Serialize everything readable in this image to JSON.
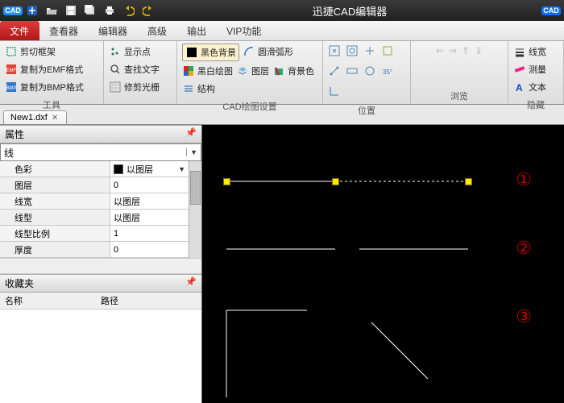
{
  "title": "迅捷CAD编辑器",
  "menu": {
    "file": "文件",
    "viewer": "查看器",
    "editor": "编辑器",
    "adv": "高级",
    "output": "输出",
    "vip": "VIP功能"
  },
  "ribbon": {
    "g1": {
      "crop": "剪切框架",
      "emf": "复制为EMF格式",
      "bmp": "复制为BMP格式",
      "label": "工具"
    },
    "g2": {
      "pts": "显示点",
      "find": "查找文字",
      "trim": "修剪光栅"
    },
    "g3": {
      "bg": "黑色背景",
      "bw": "黑白绘图",
      "bgcolor": "背景色",
      "arc": "圆滑弧形",
      "layer": "图层",
      "struct": "结构",
      "label": "CAD绘图设置"
    },
    "g4": {
      "label": "位置"
    },
    "g5": {
      "label": "浏览"
    },
    "g6": {
      "lw": "线宽",
      "measure": "测量",
      "text": "文本",
      "label": "隐藏"
    }
  },
  "doc": {
    "name": "New1.dxf"
  },
  "props": {
    "title": "属性",
    "type": "线",
    "color_k": "色彩",
    "color_v": "以图层",
    "layer_k": "图层",
    "layer_v": "0",
    "lw_k": "线宽",
    "lw_v": "以图层",
    "lt_k": "线型",
    "lt_v": "以图层",
    "lts_k": "线型比例",
    "lts_v": "1",
    "thk_k": "厚度",
    "thk_v": "0"
  },
  "fav": {
    "title": "收藏夹",
    "name": "名称",
    "path": "路径"
  },
  "annot": {
    "a": "①",
    "b": "②",
    "c": "③"
  }
}
